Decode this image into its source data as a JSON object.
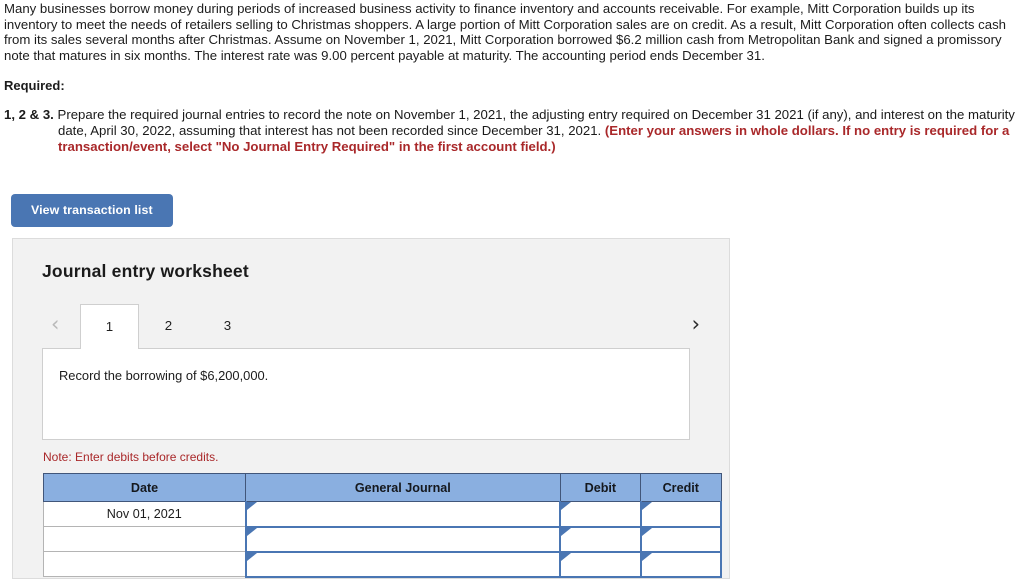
{
  "narrative": "Many businesses borrow money during periods of increased business activity to finance inventory and accounts receivable. For example, Mitt Corporation builds up its inventory to meet the needs of retailers selling to Christmas shoppers. A large portion of Mitt Corporation sales are on credit. As a result, Mitt Corporation often collects cash from its sales several months after Christmas. Assume on November 1, 2021, Mitt Corporation borrowed $6.2 million cash from Metropolitan Bank and signed a promissory note that matures in six months. The interest rate was 9.00 percent payable at maturity. The accounting period ends December 31.",
  "required": {
    "label": "Required:",
    "item_number": "1, 2 & 3.",
    "item_text": " Prepare the required journal entries to record the note on November 1, 2021, the adjusting entry required on December 31 2021 (if any), and interest on the maturity date, April 30, 2022, assuming that interest has not been recorded since December 31, 2021. ",
    "item_emphasis": "(Enter your answers in whole dollars. If no entry is required for a transaction/event, select \"No Journal Entry Required\" in the first account field.)"
  },
  "toolbar": {
    "view_transaction_list_label": "View transaction list"
  },
  "worksheet": {
    "title": "Journal entry worksheet",
    "prev_arrow": "‹",
    "next_arrow": "›",
    "tabs": [
      {
        "label": "1",
        "active": true
      },
      {
        "label": "2",
        "active": false
      },
      {
        "label": "3",
        "active": false
      }
    ],
    "instruction": "Record the borrowing of $6,200,000.",
    "note": "Note: Enter debits before credits."
  },
  "journal_table": {
    "headers": [
      "Date",
      "General Journal",
      "Debit",
      "Credit"
    ],
    "rows": [
      {
        "date": "Nov 01, 2021",
        "general_journal": "",
        "debit": "",
        "credit": ""
      },
      {
        "date": "",
        "general_journal": "",
        "debit": "",
        "credit": ""
      },
      {
        "date": "",
        "general_journal": "",
        "debit": "",
        "credit": ""
      }
    ]
  },
  "colors": {
    "accent_blue": "#4a76b3",
    "header_blue": "#8aafe0",
    "alert_red": "#a9282a",
    "panel_bg": "#f2f2f2"
  }
}
